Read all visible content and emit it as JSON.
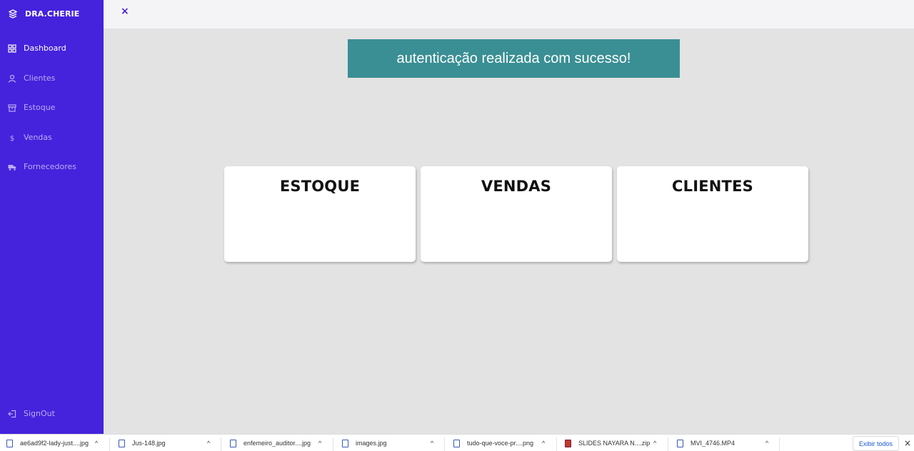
{
  "sidebar": {
    "brand": "DRA.CHERIE",
    "brand_icon": "layers-icon",
    "items": [
      {
        "label": "Dashboard",
        "icon": "grid-icon",
        "active": true
      },
      {
        "label": "Clientes",
        "icon": "user-icon",
        "active": false
      },
      {
        "label": "Estoque",
        "icon": "archive-icon",
        "active": false
      },
      {
        "label": "Vendas",
        "icon": "dollar-icon",
        "active": false
      },
      {
        "label": "Fornecedores",
        "icon": "truck-icon",
        "active": false
      }
    ],
    "signout": {
      "label": "SignOut",
      "icon": "signout-icon"
    }
  },
  "topbar": {
    "close": "×"
  },
  "toast": {
    "message": "autenticação realizada com sucesso!"
  },
  "cards": [
    {
      "title": "ESTOQUE"
    },
    {
      "title": "VENDAS"
    },
    {
      "title": "CLIENTES"
    }
  ],
  "downloads": {
    "items": [
      {
        "name": "ae6ad9f2-lady-just....jpg",
        "type": "image"
      },
      {
        "name": "Jus-148.jpg",
        "type": "image"
      },
      {
        "name": "enfemeiro_auditor....jpg",
        "type": "image"
      },
      {
        "name": "images.jpg",
        "type": "image"
      },
      {
        "name": "tudo-que-voce-pr....png",
        "type": "image"
      },
      {
        "name": "SLIDES NAYARA N....zip",
        "type": "zip"
      },
      {
        "name": "MVI_4746.MP4",
        "type": "video"
      }
    ],
    "caret": "^",
    "show_all": "Exibir todos",
    "close": "×"
  },
  "colors": {
    "sidebar": "#4522dc",
    "toast": "#3a8f94",
    "background": "#e3e3e3"
  }
}
